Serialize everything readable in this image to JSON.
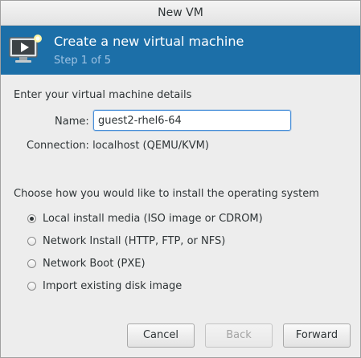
{
  "window": {
    "title": "New VM"
  },
  "banner": {
    "icon": "monitor-play-icon",
    "title": "Create a new virtual machine",
    "step": "Step 1 of 5",
    "color": "#1c6fa8"
  },
  "details": {
    "heading": "Enter your virtual machine details",
    "name_label": "Name:",
    "name_value": "guest2-rhel6-64",
    "connection": "Connection:  localhost (QEMU/KVM)"
  },
  "install": {
    "heading": "Choose how you would like to install the operating system",
    "options": [
      {
        "label": "Local install media (ISO image or CDROM)",
        "checked": true
      },
      {
        "label": "Network Install (HTTP, FTP, or NFS)",
        "checked": false
      },
      {
        "label": "Network Boot (PXE)",
        "checked": false
      },
      {
        "label": "Import existing disk image",
        "checked": false
      }
    ]
  },
  "buttons": {
    "cancel": "Cancel",
    "back": "Back",
    "forward": "Forward"
  }
}
